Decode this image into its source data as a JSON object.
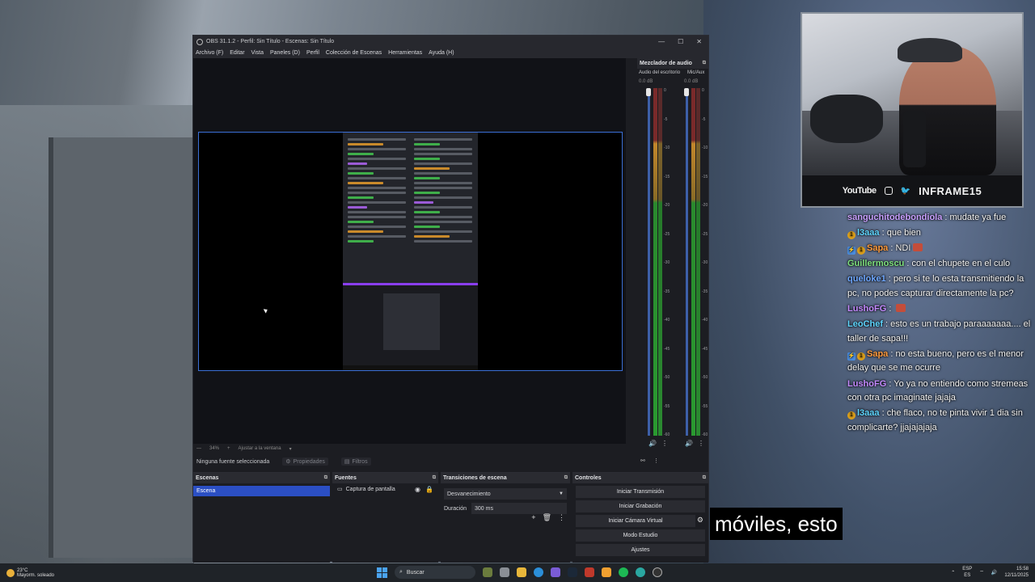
{
  "obs": {
    "title": "OBS 31.1.2 - Perfil: Sin Título - Escenas: Sin Título",
    "window_controls": [
      "—",
      "☐",
      "✕"
    ],
    "menu": [
      "Archivo (F)",
      "Editar",
      "Vista",
      "Paneles (D)",
      "Perfil",
      "Colección de Escenas",
      "Herramientas",
      "Ayuda (H)"
    ],
    "zoom": {
      "value": "34%",
      "mode": "Ajustar a la ventana"
    },
    "source_bar": {
      "status": "Ninguna fuente seleccionada",
      "properties": "Propiedades",
      "filters": "Filtros"
    },
    "mixer": {
      "title": "Mezclador de audio",
      "channels": [
        {
          "name": "Audio del escritorio",
          "db": "0.0 dB"
        },
        {
          "name": "Mic/Aux",
          "db": "0.0 dB"
        }
      ],
      "scale": [
        "0",
        "-5",
        "-10",
        "-15",
        "-20",
        "-25",
        "-30",
        "-35",
        "-40",
        "-45",
        "-50",
        "-55",
        "-60"
      ]
    },
    "scenes": {
      "title": "Escenas",
      "items": [
        "Escena"
      ]
    },
    "sources": {
      "title": "Fuentes",
      "items": [
        "Captura de pantalla"
      ]
    },
    "transitions": {
      "title": "Transiciones de escena",
      "selected": "Desvanecimiento",
      "duration_label": "Duración",
      "duration_value": "300 ms"
    },
    "controls": {
      "title": "Controles",
      "buttons": [
        "Iniciar Transmisión",
        "Iniciar Grabación",
        "Iniciar Cámara Virtual",
        "Modo Estudio",
        "Ajustes"
      ]
    }
  },
  "webcam": {
    "platform": "YouTube",
    "channel_name": "INFRAME15"
  },
  "chat": [
    {
      "user": "sanguchitodebondiola",
      "color": "#c9a0ff",
      "badges": [],
      "text": "mudate ya fue"
    },
    {
      "user": "l3aaa",
      "color": "#5fd6ff",
      "badges": [
        "gold"
      ],
      "text": "que bien"
    },
    {
      "user": "Sapa",
      "color": "#ff9b3d",
      "badges": [
        "blue",
        "gold"
      ],
      "text": "NDI",
      "emote": true
    },
    {
      "user": "Guillermoscu",
      "color": "#7ee07e",
      "badges": [],
      "text": "con el chupete en el culo"
    },
    {
      "user": "queloke1",
      "color": "#6fa8ff",
      "badges": [],
      "text": "pero si te lo esta transmitiendo la pc, no podes capturar directamente la pc?"
    },
    {
      "user": "LushoFG",
      "color": "#c48aff",
      "badges": [],
      "text": "",
      "emote": true
    },
    {
      "user": "LeoChef",
      "color": "#5fd6ff",
      "badges": [],
      "text": "esto es un trabajo paraaaaaaa.... el taller de sapa!!!"
    },
    {
      "user": "Sapa",
      "color": "#ff9b3d",
      "badges": [
        "blue",
        "gold"
      ],
      "text": "no esta bueno, pero es el menor delay que se me ocurre"
    },
    {
      "user": "LushoFG",
      "color": "#c48aff",
      "badges": [],
      "text": "Yo ya no entiendo como stremeas con otra pc imaginate jajaja"
    },
    {
      "user": "l3aaa",
      "color": "#5fd6ff",
      "badges": [
        "gold"
      ],
      "text": "che flaco, no te pinta vivir 1 dia sin complicarte? jjajajajaja"
    }
  ],
  "subtitle": "móviles, esto",
  "taskbar": {
    "weather_temp": "23°C",
    "weather_desc": "Mayorm. soleado",
    "search": "Buscar",
    "lang_top": "ESP",
    "lang_bottom": "ES",
    "time": "15:58",
    "date": "12/11/2025"
  }
}
